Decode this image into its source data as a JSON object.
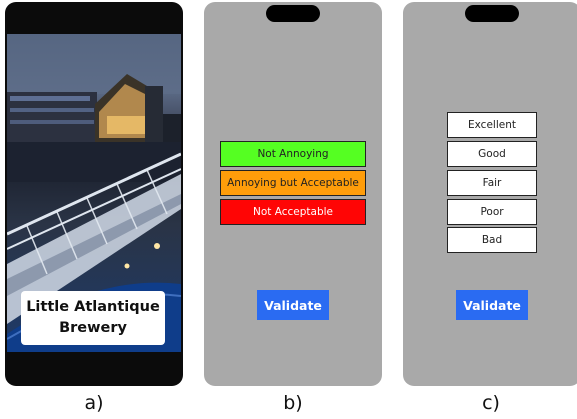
{
  "panel_a": {
    "caption_line1": "Little Atlantique",
    "caption_line2": "Brewery",
    "label": "a)"
  },
  "panel_b": {
    "options": [
      "Not Annoying",
      "Annoying but Acceptable",
      "Not Acceptable"
    ],
    "option_colors": [
      "#55ff22",
      "#ff9d0a",
      "#ff0505"
    ],
    "validate_label": "Validate",
    "label": "b)"
  },
  "panel_c": {
    "options": [
      "Excellent",
      "Good",
      "Fair",
      "Poor",
      "Bad"
    ],
    "validate_label": "Validate",
    "label": "c)"
  }
}
